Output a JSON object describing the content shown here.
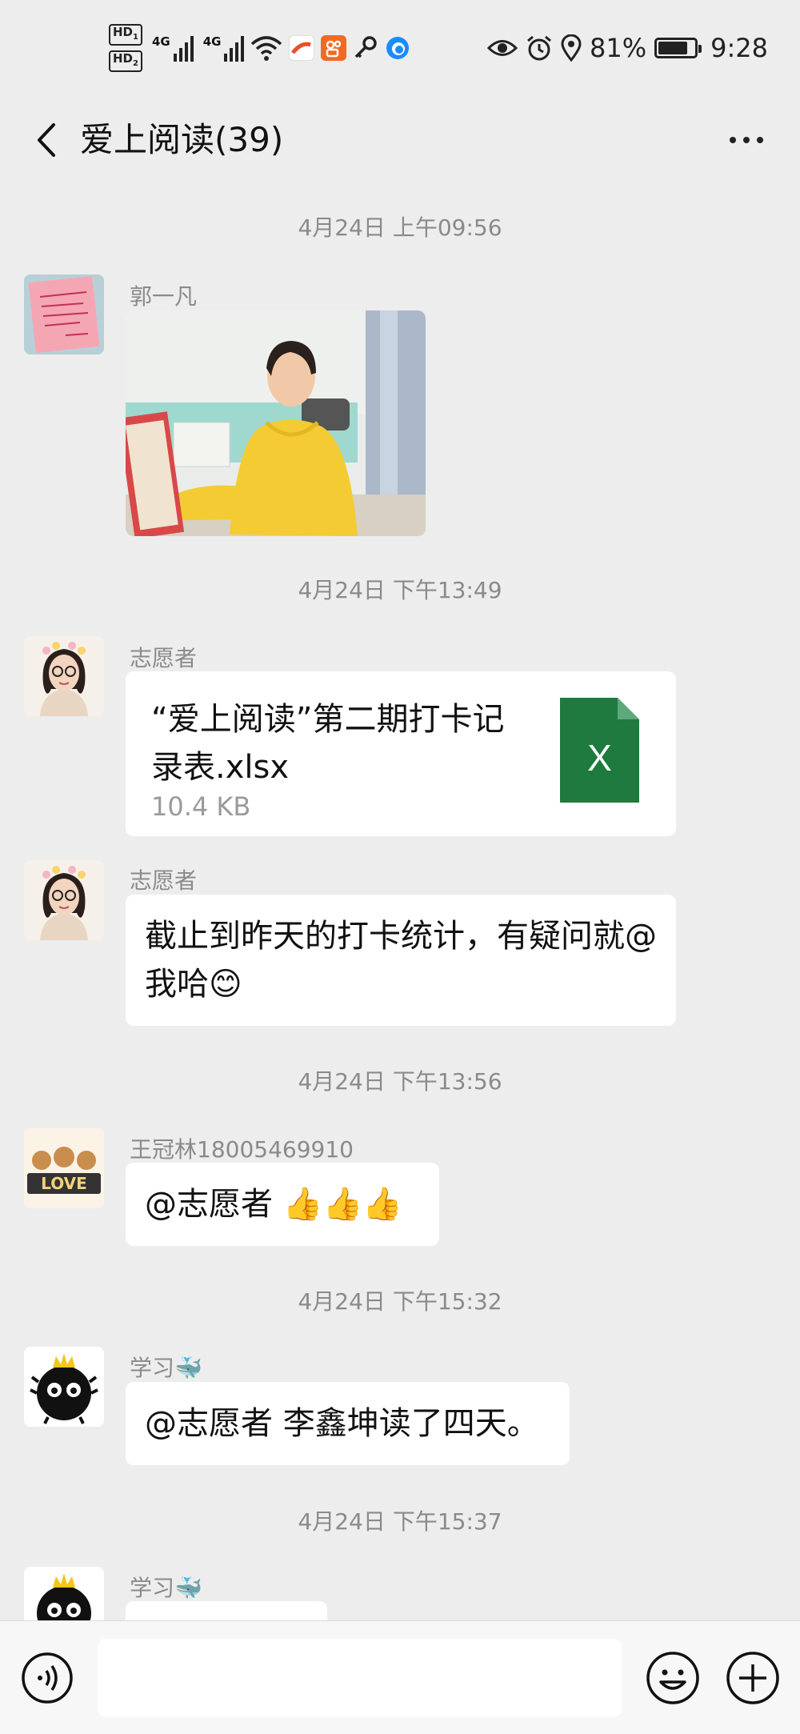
{
  "status_bar": {
    "hd1": "HD",
    "hd1_sub": "1",
    "hd2": "HD",
    "hd2_sub": "2",
    "net1": "4G",
    "net2": "4G",
    "battery_percent": "81%",
    "time": "9:28",
    "icons": [
      "eye-icon",
      "alarm-icon",
      "location-icon",
      "battery-icon"
    ]
  },
  "nav": {
    "title": "爱上阅读(39)",
    "back_icon": "chevron-left-icon",
    "more_icon": "more-dots-icon"
  },
  "messages": [
    {
      "type": "timestamp",
      "text": "4月24日 上午09:56"
    },
    {
      "type": "image",
      "sender": "郭一凡",
      "content": "photo"
    },
    {
      "type": "timestamp",
      "text": "4月24日 下午13:49"
    },
    {
      "type": "file",
      "sender": "志愿者",
      "file_name": "“爱上阅读”第二期打卡记录表.xlsx",
      "file_size": "10.4 KB",
      "file_icon_letter": "X",
      "file_icon_color": "#1f7a3f"
    },
    {
      "type": "text",
      "sender": "志愿者",
      "text": "截止到昨天的打卡统计，有疑问就@我哈😊"
    },
    {
      "type": "timestamp",
      "text": "4月24日 下午13:56"
    },
    {
      "type": "text",
      "sender": "王冠林18005469910",
      "text": "@志愿者 👍👍👍"
    },
    {
      "type": "timestamp",
      "text": "4月24日 下午15:32"
    },
    {
      "type": "text",
      "sender": "学习🐳",
      "text": "@志愿者  李鑫坤读了四天。"
    },
    {
      "type": "timestamp",
      "text": "4月24日 下午15:37"
    },
    {
      "type": "text",
      "sender": "学习🐳",
      "text": ""
    }
  ],
  "input_bar": {
    "voice_icon": "voice-icon",
    "input_value": "",
    "emoji_icon": "emoji-icon",
    "plus_icon": "plus-icon"
  },
  "colors": {
    "background": "#ededed",
    "bubble": "#ffffff",
    "timestamp": "#8a8a8a",
    "excel_green": "#1f7a3f"
  }
}
